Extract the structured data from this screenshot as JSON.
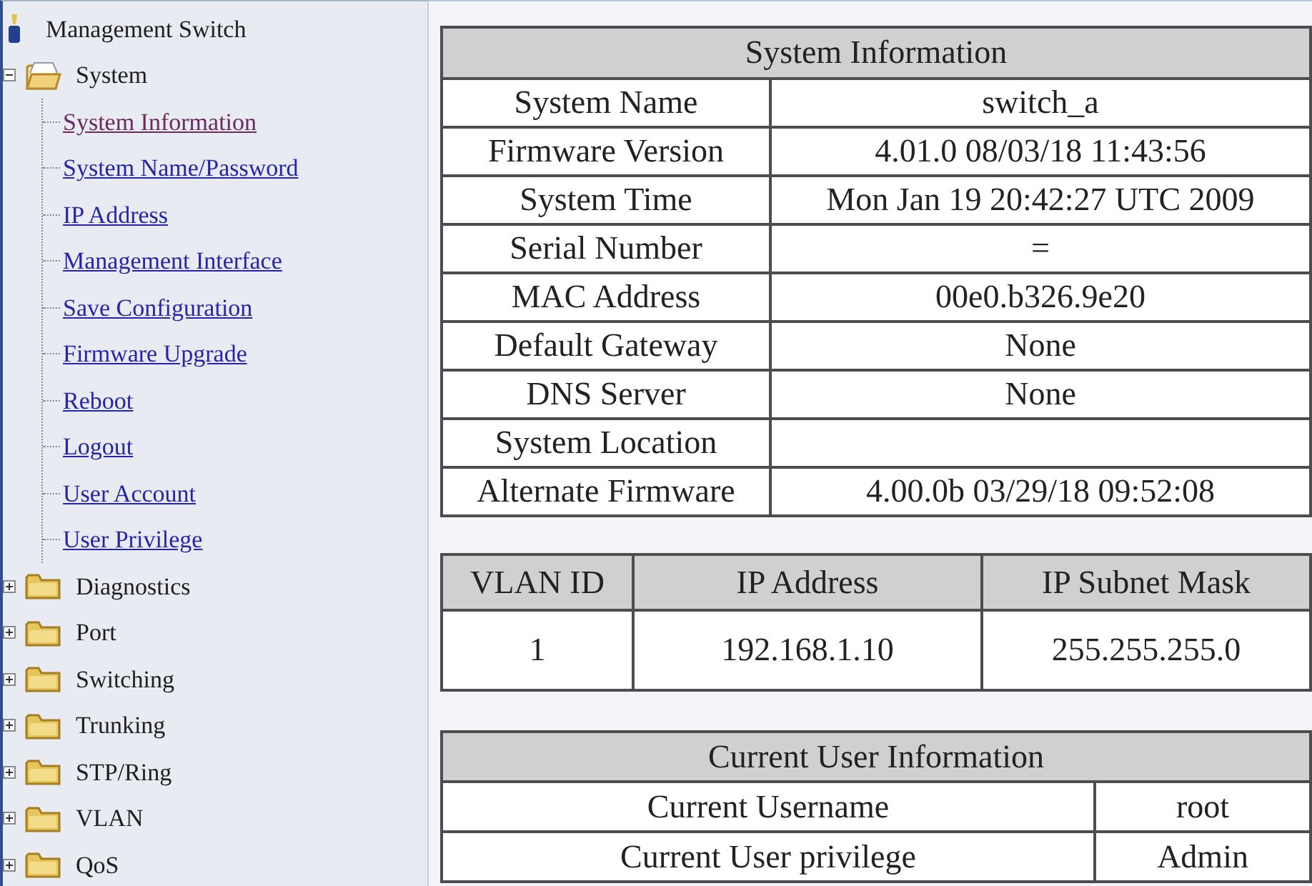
{
  "sidebar": {
    "root": {
      "label": "Management Switch"
    },
    "folders": [
      {
        "label": "System",
        "expanded": true,
        "children": [
          {
            "label": "System Information",
            "visited": true
          },
          {
            "label": "System Name/Password",
            "visited": false
          },
          {
            "label": "IP Address",
            "visited": false
          },
          {
            "label": "Management Interface",
            "visited": false
          },
          {
            "label": "Save Configuration",
            "visited": false
          },
          {
            "label": "Firmware Upgrade",
            "visited": false
          },
          {
            "label": "Reboot",
            "visited": false
          },
          {
            "label": "Logout",
            "visited": false
          },
          {
            "label": "User Account",
            "visited": false
          },
          {
            "label": "User Privilege",
            "visited": false
          }
        ]
      },
      {
        "label": "Diagnostics",
        "expanded": false
      },
      {
        "label": "Port",
        "expanded": false
      },
      {
        "label": "Switching",
        "expanded": false
      },
      {
        "label": "Trunking",
        "expanded": false
      },
      {
        "label": "STP/Ring",
        "expanded": false
      },
      {
        "label": "VLAN",
        "expanded": false
      },
      {
        "label": "QoS",
        "expanded": false
      }
    ]
  },
  "system_information": {
    "title": "System Information",
    "rows": [
      {
        "label": "System Name",
        "value": "switch_a"
      },
      {
        "label": "Firmware Version",
        "value": "4.01.0 08/03/18 11:43:56"
      },
      {
        "label": "System Time",
        "value": "Mon Jan 19 20:42:27 UTC 2009"
      },
      {
        "label": "Serial Number",
        "value": "="
      },
      {
        "label": "MAC Address",
        "value": "00e0.b326.9e20"
      },
      {
        "label": "Default Gateway",
        "value": "None"
      },
      {
        "label": "DNS Server",
        "value": "None"
      },
      {
        "label": "System Location"
      },
      {
        "label": "Alternate Firmware",
        "value": "4.00.0b 03/29/18 09:52:08"
      }
    ]
  },
  "vlan_table": {
    "columns": [
      "VLAN ID",
      "IP Address",
      "IP Subnet Mask"
    ],
    "rows": [
      [
        "1",
        "192.168.1.10",
        "255.255.255.0"
      ]
    ]
  },
  "current_user": {
    "title": "Current User Information",
    "rows": [
      {
        "label": "Current Username",
        "value": "root"
      },
      {
        "label": "Current User privilege",
        "value": "Admin"
      }
    ]
  }
}
